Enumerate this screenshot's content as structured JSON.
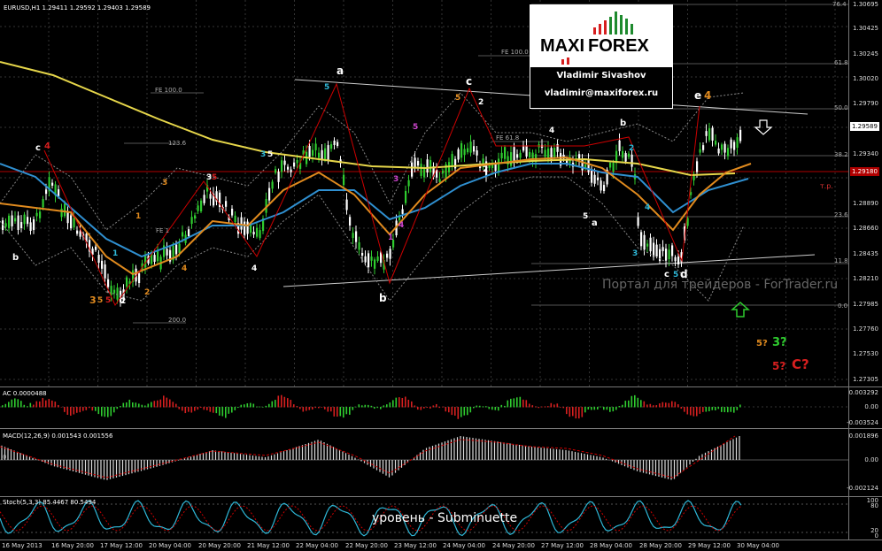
{
  "chart": {
    "symbol_header": "EURUSD,H1  1.29411  1.29592  1.29403  1.29589",
    "current_price": "1.29589",
    "red_level_price": "1.29180",
    "tp_label": "т.р.",
    "top_right_level": "76.4",
    "price_axis": [
      "1.30695",
      "1.30425",
      "1.30245",
      "1.30020",
      "1.29790",
      "1.29589",
      "1.29340",
      "1.29115",
      "1.28890",
      "1.28660",
      "1.28435",
      "1.28210",
      "1.27985",
      "1.27760",
      "1.27530",
      "1.27305"
    ],
    "fib_right": [
      "61.8",
      "50.0",
      "38.2",
      "23.6",
      "11.8",
      "0.0"
    ],
    "fe_labels": {
      "fe100_top": "FE 100.0",
      "fe100_left": "FE 100.0",
      "fe1236": "123.6",
      "fe618": "FE 61.8",
      "fe_left_mid": "FE 1",
      "fe200": "200.0"
    }
  },
  "logo": {
    "brand_left": "MAXI",
    "brand_right": "FOREX",
    "author": "Vladimir Sivashov",
    "email": "vladimir@maxiforex.ru"
  },
  "watermark": "Портал для трейдеров - ForTrader.ru",
  "wave_labels": {
    "a_top": "a",
    "b_bottom": "b",
    "c_top": "c",
    "e_top": "e",
    "e_num": "4",
    "b_right": "b",
    "a_right": "a",
    "c_left_bottom": "c",
    "d_bottom": "d",
    "q5_orange": "5?",
    "q3_green": "3?",
    "q5_red": "5?",
    "qC_red": "C?",
    "c_left": "c",
    "c_left_num": "4",
    "b_left": "b"
  },
  "wave_nums": [
    "1",
    "2",
    "3",
    "4",
    "5"
  ],
  "indicators": {
    "ac": {
      "title": "AC 0.0000488",
      "axis": [
        "0.003292",
        "0.00",
        "-0.003524"
      ]
    },
    "macd": {
      "title": "MACD(12,26,9) 0.001543 0.001556",
      "axis": [
        "0.001896",
        "0.00",
        "-0.002124"
      ]
    },
    "stoch": {
      "title": "Stoch(5,3,3) 85.4467 80.5494",
      "axis": [
        "100",
        "80",
        "20",
        "0"
      ],
      "bottom_text": "уровень - Subminuette"
    }
  },
  "time_axis": [
    "16 May 2013",
    "16 May 20:00",
    "17 May 12:00",
    "20 May 04:00",
    "20 May 20:00",
    "21 May 12:00",
    "22 May 04:00",
    "22 May 20:00",
    "23 May 12:00",
    "24 May 04:00",
    "24 May 20:00",
    "27 May 12:00",
    "28 May 04:00",
    "28 May 20:00",
    "29 May 12:00",
    "30 May 04:00"
  ],
  "colors": {
    "ma_yellow": "#e6d64a",
    "ma_blue": "#2f8fd0",
    "ma_orange": "#e08a1e",
    "red_line": "#b00000",
    "bull": "#2fcc2f",
    "bear": "#ffffff",
    "logo_red": "#d61f1f",
    "logo_green": "#1e8a2e"
  }
}
